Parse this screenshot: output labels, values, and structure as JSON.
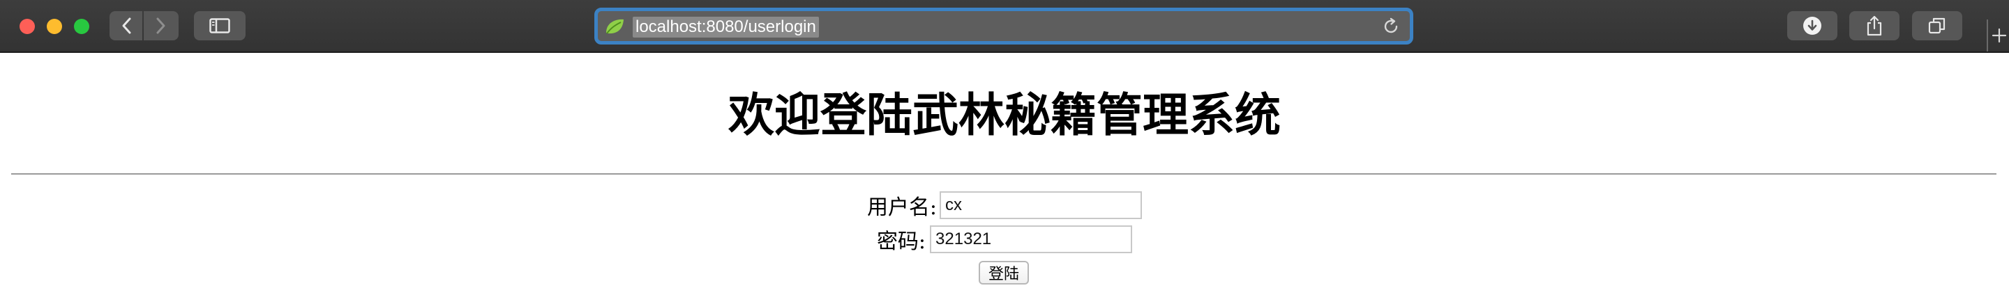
{
  "browser": {
    "url": "localhost:8080/userlogin",
    "icons": {
      "back": "chevron-left-icon",
      "forward": "chevron-right-icon",
      "sidebar": "sidebar-icon",
      "reload": "reload-icon",
      "download": "download-icon",
      "share": "share-icon",
      "tabs": "tabs-icon",
      "new_tab": "plus-icon",
      "favicon": "spring-leaf-icon"
    }
  },
  "page": {
    "title": "欢迎登陆武林秘籍管理系统",
    "username_label": "用户名:",
    "username_value": "cx",
    "password_label": "密码:",
    "password_value": "321321",
    "login_button": "登陆"
  }
}
